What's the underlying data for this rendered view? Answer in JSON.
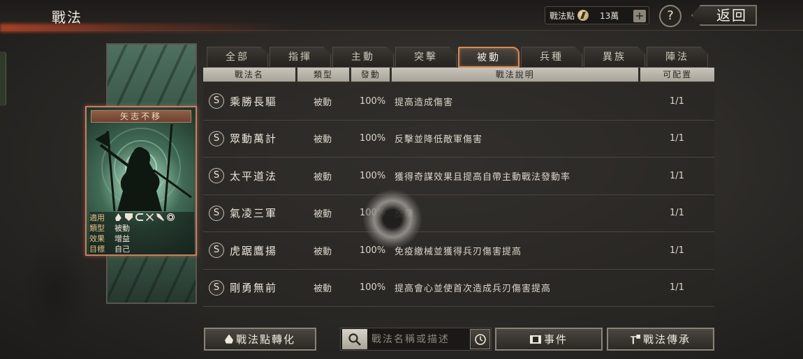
{
  "header": {
    "title": "戰法",
    "points_label": "戰法點",
    "points_value": "13萬",
    "plus_label": "+",
    "help_label": "?",
    "back_label": "返回"
  },
  "card": {
    "name": "矢志不移",
    "info": [
      {
        "key": "適用",
        "value": ""
      },
      {
        "key": "類型",
        "value": "被動"
      },
      {
        "key": "效果",
        "value": "增益"
      },
      {
        "key": "目標",
        "value": "自己"
      }
    ],
    "applicable_icons": [
      "cavalry-icon",
      "shield-icon",
      "bow-icon",
      "crossed-weapons-icon",
      "spear-icon",
      "chariot-wheel-icon"
    ]
  },
  "tabs": [
    {
      "label": "全部",
      "active": false
    },
    {
      "label": "指揮",
      "active": false
    },
    {
      "label": "主動",
      "active": false
    },
    {
      "label": "突擊",
      "active": false
    },
    {
      "label": "被動",
      "active": true
    },
    {
      "label": "兵種",
      "active": false
    },
    {
      "label": "異族",
      "active": false
    },
    {
      "label": "陣法",
      "active": false
    }
  ],
  "table": {
    "headers": {
      "name": "戰法名",
      "type": "類型",
      "trigger": "發動",
      "desc": "戰法說明",
      "avail": "可配置"
    },
    "rows": [
      {
        "grade": "S",
        "name": "乘勝長驅",
        "type": "被動",
        "trigger": "100%",
        "desc": "提高造成傷害",
        "avail": "1/1"
      },
      {
        "grade": "S",
        "name": "眾動萬計",
        "type": "被動",
        "trigger": "100%",
        "desc": "反擊並降低敵軍傷害",
        "avail": "1/1"
      },
      {
        "grade": "S",
        "name": "太平道法",
        "type": "被動",
        "trigger": "100%",
        "desc": "獲得奇謀效果且提高自帶主動戰法發動率",
        "avail": "1/1"
      },
      {
        "grade": "S",
        "name": "氣凌三軍",
        "type": "被動",
        "trigger": "100%",
        "desc": "反擊",
        "avail": "1/1"
      },
      {
        "grade": "S",
        "name": "虎踞鷹揚",
        "type": "被動",
        "trigger": "100%",
        "desc": "免疫繳械並獲得兵刃傷害提高",
        "avail": "1/1"
      },
      {
        "grade": "S",
        "name": "剛勇無前",
        "type": "被動",
        "trigger": "100%",
        "desc": "提高會心並使首次造成兵刃傷害提高",
        "avail": "1/1"
      }
    ]
  },
  "bottom": {
    "convert_label": "戰法點轉化",
    "search_placeholder": "戰法名稱或描述",
    "event_label": "事件",
    "inherit_label": "戰法傳承"
  },
  "colors": {
    "accent": "#d98a57",
    "card_border": "#c97f64",
    "header_fill": "#c8c4ba"
  }
}
